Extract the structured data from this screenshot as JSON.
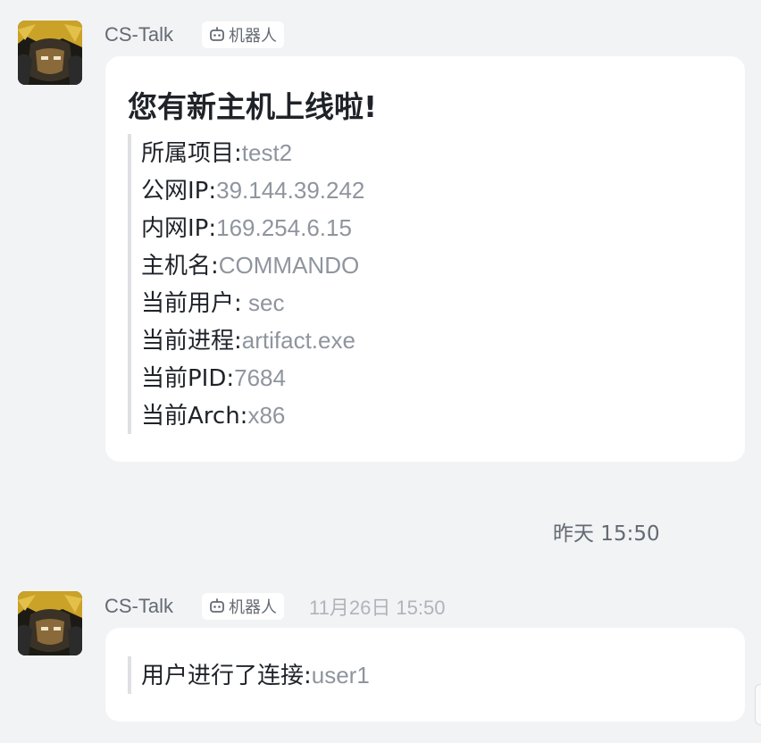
{
  "messages": [
    {
      "sender": "CS-Talk",
      "badge": "机器人",
      "card": {
        "title": "您有新主机上线啦!",
        "fields": [
          {
            "label": "所属项目:",
            "value": "test2"
          },
          {
            "label": "公网IP:",
            "value": "39.144.39.242"
          },
          {
            "label": "内网IP:",
            "value": "169.254.6.15"
          },
          {
            "label": "主机名:",
            "value": "COMMANDO"
          },
          {
            "label": "当前用户:",
            "value": " sec"
          },
          {
            "label": "当前进程:",
            "value": "artifact.exe"
          },
          {
            "label": "当前PID:",
            "value": "7684"
          },
          {
            "label": "当前Arch:",
            "value": "x86"
          }
        ]
      }
    },
    {
      "sender": "CS-Talk",
      "badge": "机器人",
      "time": "11月26日 15:50",
      "text": {
        "label": "用户进行了连接:",
        "value": "user1"
      }
    }
  ],
  "divider_time": "昨天 15:50",
  "icons": {
    "avatar": "avatar-icon",
    "bot": "robot-icon"
  },
  "colors": {
    "background": "#f2f3f5",
    "bubble": "#ffffff",
    "label": "#1f2329",
    "value": "#8f959e",
    "secondary": "#646a73"
  }
}
